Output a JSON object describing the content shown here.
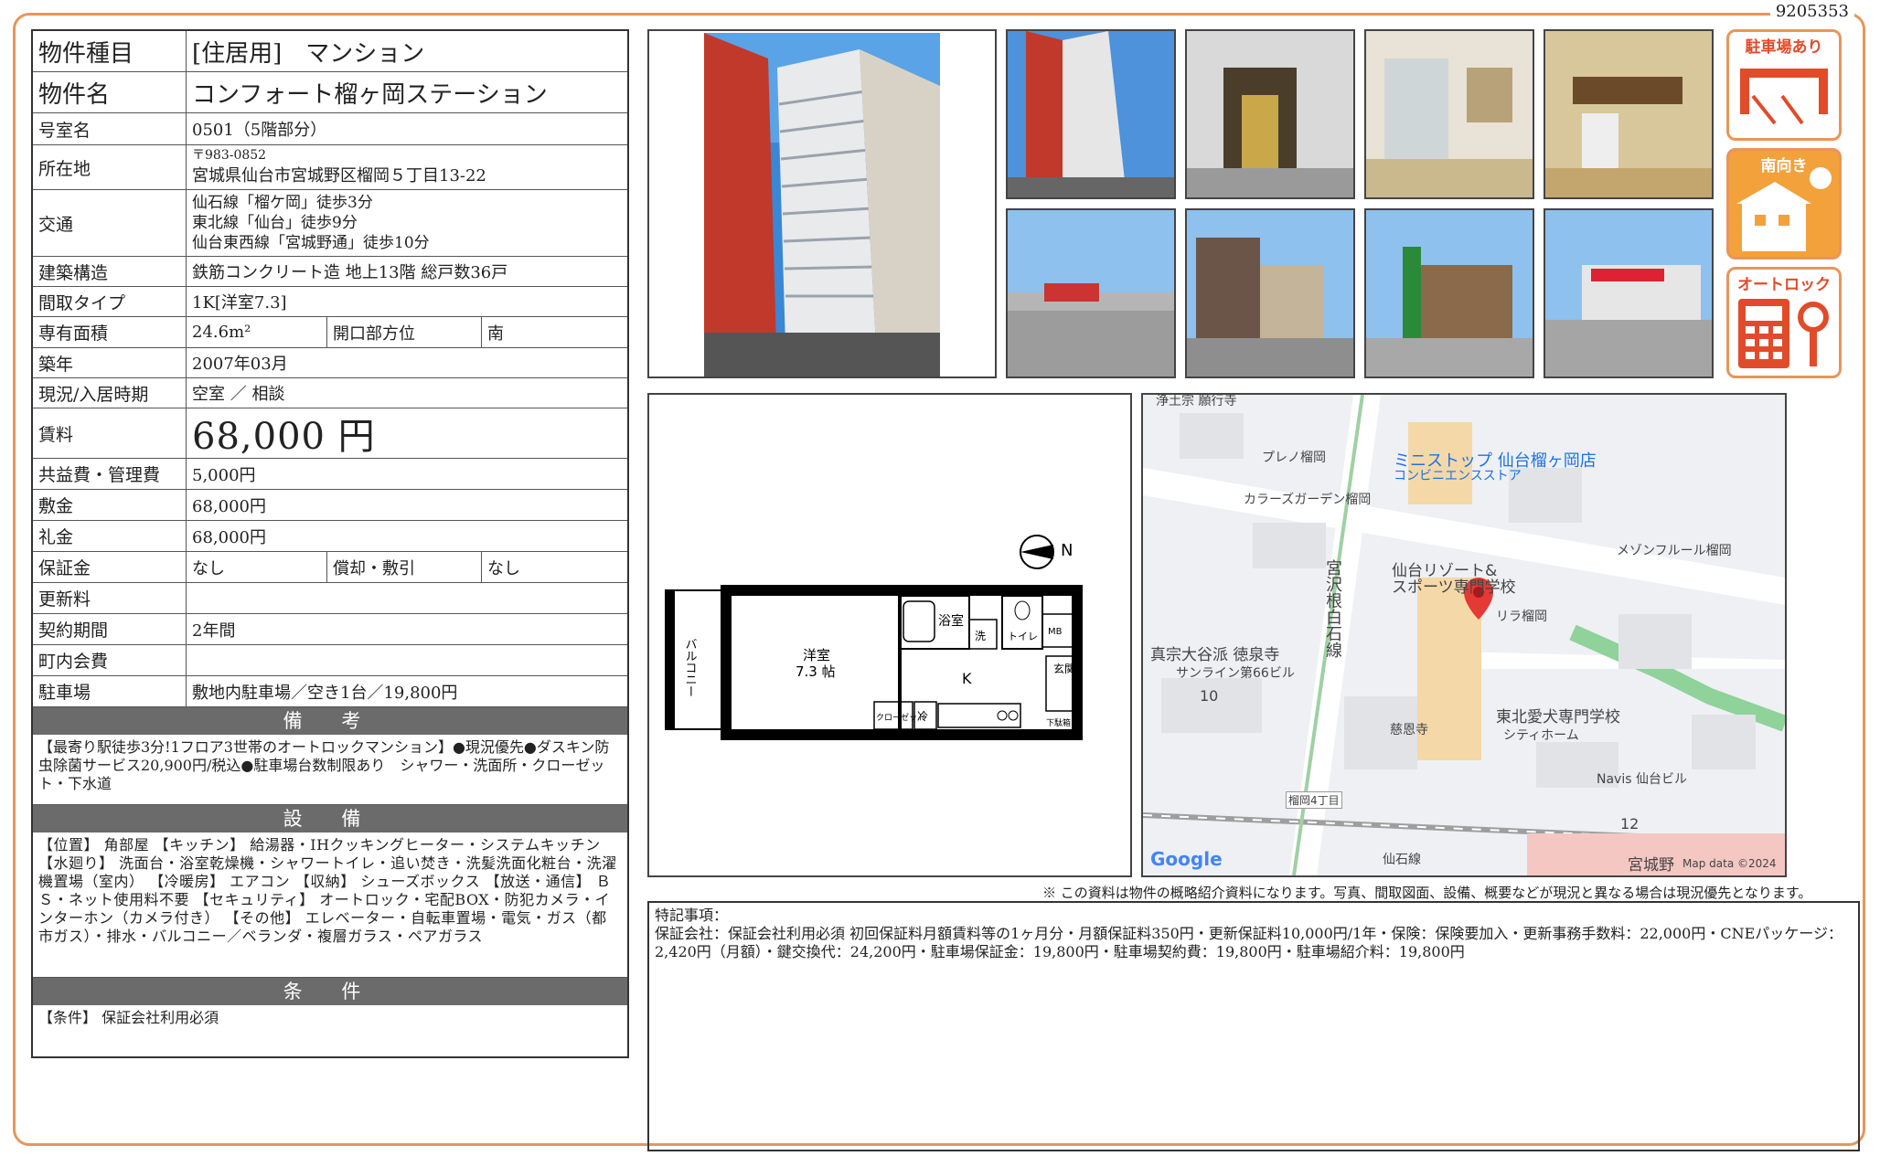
{
  "doc_id": "9205353",
  "info": {
    "type_label": "物件種目",
    "type_value": "[住居用]　マンション",
    "name_label": "物件名",
    "name_value": "コンフォート榴ヶ岡ステーション",
    "room_label": "号室名",
    "room_value": "0501（5階部分）",
    "address_label": "所在地",
    "postal": "〒983-0852",
    "address_value": "宮城県仙台市宮城野区榴岡５丁目13-22",
    "access_label": "交通",
    "access_lines": [
      "仙石線「榴ケ岡」徒歩3分",
      "東北線「仙台」徒歩9分",
      "仙台東西線「宮城野通」徒歩10分"
    ],
    "structure_label": "建築構造",
    "structure_value": "鉄筋コンクリート造  地上13階  総戸数36戸",
    "layout_label": "間取タイプ",
    "layout_value": "1K[洋室7.3]",
    "area_label": "専有面積",
    "area_value": "24.6m²",
    "direction_label": "開口部方位",
    "direction_value": "南",
    "built_label": "築年",
    "built_value": "2007年03月",
    "status_label": "現況/入居時期",
    "status_value": "空室 ／ 相談",
    "rent_label": "賃料",
    "rent_value": "68,000 円",
    "fee_label": "共益費・管理費",
    "fee_value": "5,000円",
    "deposit_label": "敷金",
    "deposit_value": "68,000円",
    "keymoney_label": "礼金",
    "keymoney_value": "68,000円",
    "guarantee_label": "保証金",
    "guarantee_value": "なし",
    "amort_label": "償却・敷引",
    "amort_value": "なし",
    "renewal_label": "更新料",
    "renewal_value": "",
    "contract_label": "契約期間",
    "contract_value": "2年間",
    "community_label": "町内会費",
    "community_value": "",
    "parking_label": "駐車場",
    "parking_value": "敷地内駐車場／空き1台／19,800円"
  },
  "remarks": {
    "header": "備 考",
    "text": "【最寄り駅徒歩3分!1フロア3世帯のオートロックマンション】●現況優先●ダスキン防虫除菌サービス20,900円/税込●駐車場台数制限あり　シャワー・洗面所・クローゼット・下水道"
  },
  "equipment": {
    "header": "設 備",
    "text": "【位置】 角部屋 【キッチン】 給湯器・IHクッキングヒーター・システムキッチン 【水廻り】 洗面台・浴室乾燥機・シャワートイレ・追い焚き・洗髪洗面化粧台・洗濯機置場（室内） 【冷暖房】 エアコン 【収納】 シューズボックス 【放送・通信】 ＢＳ・ネット使用料不要 【セキュリティ】 オートロック・宅配BOX・防犯カメラ・インターホン（カメラ付き） 【その他】 エレベーター・自転車置場・電気・ガス（都市ガス）・排水・バルコニー／ベランダ・複層ガラス・ペアガラス"
  },
  "conditions": {
    "header": "条 件",
    "text": "【条件】 保証会社利用必須"
  },
  "badges": [
    "駐車場あり",
    "南向き",
    "オートロック"
  ],
  "floorplan": {
    "north": "N",
    "balcony": "バルコニー",
    "western_room": "洋室",
    "western_size": "7.3 帖",
    "bath": "浴室",
    "wash": "洗",
    "toilet": "トイレ",
    "mb": "MB",
    "kitchen": "K",
    "entrance": "玄関",
    "shoebox": "下駄箱",
    "closet": "クローゼット",
    "fridge": "冷"
  },
  "map": {
    "labels": [
      "浄土宗 願行寺",
      "プレノ榴岡",
      "ミニストップ 仙台榴ヶ岡店",
      "コンビニエンスストア",
      "カラーズガーデン榴岡",
      "メゾンフルール榴岡",
      "宮沢根白石線",
      "仙台リゾート&",
      "スポーツ専門学校",
      "リラ榴岡",
      "真宗大谷派 徳泉寺",
      "サンライン第66ビル",
      "10",
      "慈恩寺",
      "東北愛犬専門学校",
      "シティホーム",
      "Navis 仙台ビル",
      "12",
      "榴岡4丁目",
      "仙石線",
      "宮城野",
      "Google",
      "Map data ©2024"
    ]
  },
  "disclaimer": "※ この資料は物件の概略紹介資料になります。写真、間取図面、設備、概要などが現況と異なる場合は現況優先となります。",
  "special": {
    "title": "特記事項：",
    "text": "保証会社：保証会社利用必須 初回保証料月額賃料等の1ヶ月分・月額保証料350円・更新保証料10,000円/1年・保険：保険要加入・更新事務手数料：22,000円・CNEパッケージ：2,420円（月額）・鍵交換代：24,200円・駐車場保証金：19,800円・駐車場契約費：19,800円・駐車場紹介料：19,800円"
  }
}
